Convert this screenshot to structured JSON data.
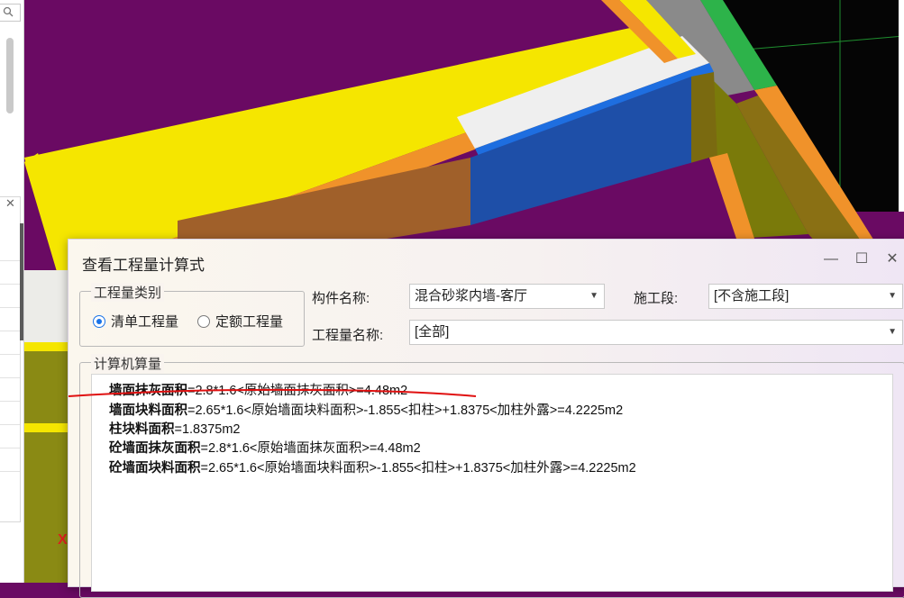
{
  "dialog": {
    "title": "查看工程量计算式",
    "controls": {
      "minimize": "—",
      "maximize": "☐",
      "close": "✕"
    },
    "quantity_type": {
      "legend": "工程量类别",
      "options": [
        {
          "label": "清单工程量",
          "selected": true
        },
        {
          "label": "定额工程量",
          "selected": false
        }
      ]
    },
    "component": {
      "label": "构件名称:",
      "value": "混合砂浆内墙-客厅"
    },
    "stage": {
      "label": "施工段:",
      "value": "[不含施工段]"
    },
    "quantity_name": {
      "label": "工程量名称:",
      "value": "[全部]"
    },
    "calc": {
      "legend": "计算机算量",
      "lines": [
        {
          "name": "墙面抹灰面积",
          "formula": "=2.8*1.6<原始墙面抹灰面积>=4.48m2"
        },
        {
          "name": "墙面块料面积",
          "formula": "=2.65*1.6<原始墙面块料面积>-1.855<扣柱>+1.8375<加柱外露>=4.2225m2"
        },
        {
          "name": "柱块料面积",
          "formula": "=1.8375m2"
        },
        {
          "name": "砼墙面抹灰面积",
          "formula": "=2.8*1.6<原始墙面抹灰面积>=4.48m2"
        },
        {
          "name": "砼墙面块料面积",
          "formula": "=2.65*1.6<原始墙面块料面积>-1.855<扣柱>+1.8375<加柱外露>=4.2225m2"
        }
      ]
    }
  },
  "sidebar": {
    "close_glyph": "✕"
  },
  "canvas": {
    "axis_label": "X"
  },
  "colors": {
    "purple": "#6a0a63",
    "yellow": "#f5e600",
    "orange": "#f0922a",
    "blue": "#1e4fa8",
    "annotation_red": "#e01010"
  }
}
